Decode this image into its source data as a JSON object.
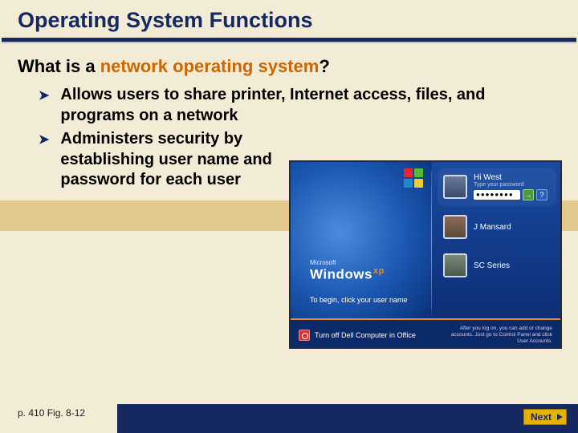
{
  "title": "Operating System Functions",
  "question_prefix": "What is a ",
  "question_highlight": "network operating system",
  "question_suffix": "?",
  "bullets": [
    "Allows users to share printer, Internet access, files, and programs on a network",
    "Administers security by establishing user name and password for each user"
  ],
  "login": {
    "brand_small": "Microsoft",
    "brand_main": "Windows",
    "brand_xp": "xp",
    "begin": "To begin, click your user name",
    "users": [
      {
        "name": "Hi West",
        "hint": "Type your password",
        "password_mask": "●●●●●●●●"
      },
      {
        "name": "J Mansard"
      },
      {
        "name": "SC Series"
      }
    ],
    "turnoff": "Turn off Dell Computer in Office",
    "footer_hint": "After you log on, you can add or change accounts. Just go to Control Panel and click User Accounts."
  },
  "pageref": "p. 410 Fig. 8-12",
  "next": "Next"
}
